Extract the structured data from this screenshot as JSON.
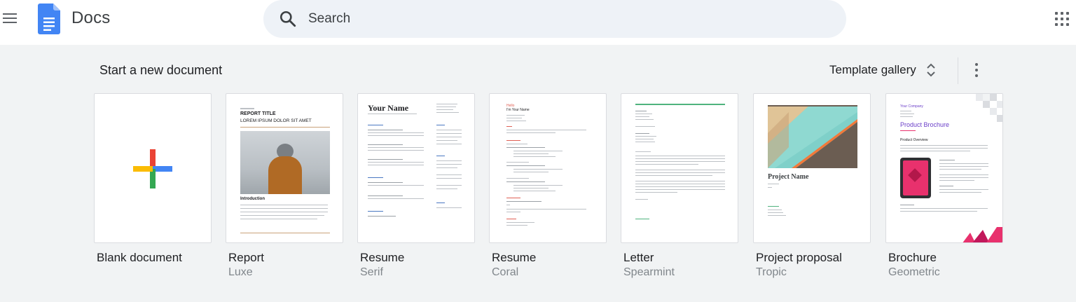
{
  "header": {
    "app_name": "Docs",
    "search_placeholder": "Search"
  },
  "templates": {
    "section_title": "Start a new document",
    "gallery_label": "Template gallery",
    "cards": [
      {
        "title": "Blank document",
        "subtitle": ""
      },
      {
        "title": "Report",
        "subtitle": "Luxe"
      },
      {
        "title": "Resume",
        "subtitle": "Serif"
      },
      {
        "title": "Resume",
        "subtitle": "Coral"
      },
      {
        "title": "Letter",
        "subtitle": "Spearmint"
      },
      {
        "title": "Project proposal",
        "subtitle": "Tropic"
      },
      {
        "title": "Brochure",
        "subtitle": "Geometric"
      }
    ]
  },
  "thumbnails": {
    "report": {
      "label": "REPORT TITLE",
      "subtitle": "LOREM IPSUM DOLOR SIT AMET",
      "section": "Introduction"
    },
    "resume_serif": {
      "name": "Your Name"
    },
    "resume_coral": {
      "name": "Hello",
      "subname": "I'm Your Name"
    },
    "proposal": {
      "heading": "Project Name"
    },
    "brochure": {
      "company": "Your Company",
      "heading": "Product Brochure",
      "section": "Product Overview"
    }
  },
  "colors": {
    "docs_blue": "#4285f4",
    "page_bg": "#f1f3f4",
    "search_bg": "#eef2f7",
    "coral": "#e06055",
    "spearmint": "#4fb37e",
    "brochure_purple": "#6b3fc9",
    "brochure_pink": "#e8316d"
  }
}
